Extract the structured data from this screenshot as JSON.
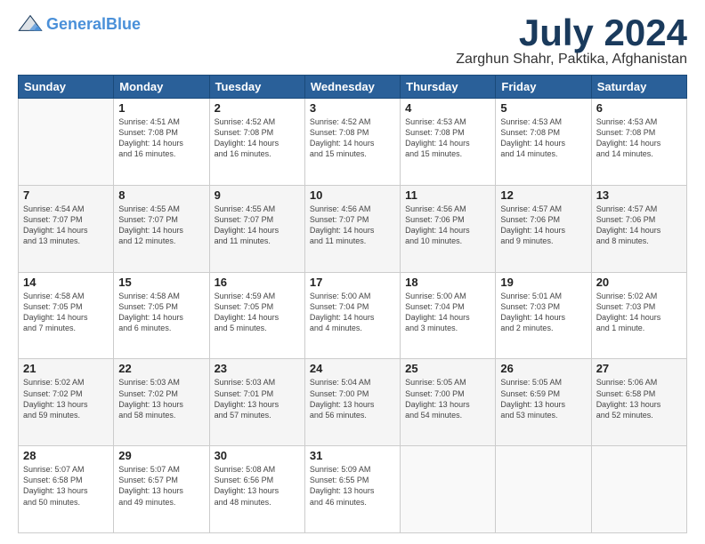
{
  "logo": {
    "name1": "General",
    "name2": "Blue",
    "tagline": ""
  },
  "title": "July 2024",
  "subtitle": "Zarghun Shahr, Paktika, Afghanistan",
  "headers": [
    "Sunday",
    "Monday",
    "Tuesday",
    "Wednesday",
    "Thursday",
    "Friday",
    "Saturday"
  ],
  "weeks": [
    [
      {
        "num": "",
        "info": ""
      },
      {
        "num": "1",
        "info": "Sunrise: 4:51 AM\nSunset: 7:08 PM\nDaylight: 14 hours\nand 16 minutes."
      },
      {
        "num": "2",
        "info": "Sunrise: 4:52 AM\nSunset: 7:08 PM\nDaylight: 14 hours\nand 16 minutes."
      },
      {
        "num": "3",
        "info": "Sunrise: 4:52 AM\nSunset: 7:08 PM\nDaylight: 14 hours\nand 15 minutes."
      },
      {
        "num": "4",
        "info": "Sunrise: 4:53 AM\nSunset: 7:08 PM\nDaylight: 14 hours\nand 15 minutes."
      },
      {
        "num": "5",
        "info": "Sunrise: 4:53 AM\nSunset: 7:08 PM\nDaylight: 14 hours\nand 14 minutes."
      },
      {
        "num": "6",
        "info": "Sunrise: 4:53 AM\nSunset: 7:08 PM\nDaylight: 14 hours\nand 14 minutes."
      }
    ],
    [
      {
        "num": "7",
        "info": "Sunrise: 4:54 AM\nSunset: 7:07 PM\nDaylight: 14 hours\nand 13 minutes."
      },
      {
        "num": "8",
        "info": "Sunrise: 4:55 AM\nSunset: 7:07 PM\nDaylight: 14 hours\nand 12 minutes."
      },
      {
        "num": "9",
        "info": "Sunrise: 4:55 AM\nSunset: 7:07 PM\nDaylight: 14 hours\nand 11 minutes."
      },
      {
        "num": "10",
        "info": "Sunrise: 4:56 AM\nSunset: 7:07 PM\nDaylight: 14 hours\nand 11 minutes."
      },
      {
        "num": "11",
        "info": "Sunrise: 4:56 AM\nSunset: 7:06 PM\nDaylight: 14 hours\nand 10 minutes."
      },
      {
        "num": "12",
        "info": "Sunrise: 4:57 AM\nSunset: 7:06 PM\nDaylight: 14 hours\nand 9 minutes."
      },
      {
        "num": "13",
        "info": "Sunrise: 4:57 AM\nSunset: 7:06 PM\nDaylight: 14 hours\nand 8 minutes."
      }
    ],
    [
      {
        "num": "14",
        "info": "Sunrise: 4:58 AM\nSunset: 7:05 PM\nDaylight: 14 hours\nand 7 minutes."
      },
      {
        "num": "15",
        "info": "Sunrise: 4:58 AM\nSunset: 7:05 PM\nDaylight: 14 hours\nand 6 minutes."
      },
      {
        "num": "16",
        "info": "Sunrise: 4:59 AM\nSunset: 7:05 PM\nDaylight: 14 hours\nand 5 minutes."
      },
      {
        "num": "17",
        "info": "Sunrise: 5:00 AM\nSunset: 7:04 PM\nDaylight: 14 hours\nand 4 minutes."
      },
      {
        "num": "18",
        "info": "Sunrise: 5:00 AM\nSunset: 7:04 PM\nDaylight: 14 hours\nand 3 minutes."
      },
      {
        "num": "19",
        "info": "Sunrise: 5:01 AM\nSunset: 7:03 PM\nDaylight: 14 hours\nand 2 minutes."
      },
      {
        "num": "20",
        "info": "Sunrise: 5:02 AM\nSunset: 7:03 PM\nDaylight: 14 hours\nand 1 minute."
      }
    ],
    [
      {
        "num": "21",
        "info": "Sunrise: 5:02 AM\nSunset: 7:02 PM\nDaylight: 13 hours\nand 59 minutes."
      },
      {
        "num": "22",
        "info": "Sunrise: 5:03 AM\nSunset: 7:02 PM\nDaylight: 13 hours\nand 58 minutes."
      },
      {
        "num": "23",
        "info": "Sunrise: 5:03 AM\nSunset: 7:01 PM\nDaylight: 13 hours\nand 57 minutes."
      },
      {
        "num": "24",
        "info": "Sunrise: 5:04 AM\nSunset: 7:00 PM\nDaylight: 13 hours\nand 56 minutes."
      },
      {
        "num": "25",
        "info": "Sunrise: 5:05 AM\nSunset: 7:00 PM\nDaylight: 13 hours\nand 54 minutes."
      },
      {
        "num": "26",
        "info": "Sunrise: 5:05 AM\nSunset: 6:59 PM\nDaylight: 13 hours\nand 53 minutes."
      },
      {
        "num": "27",
        "info": "Sunrise: 5:06 AM\nSunset: 6:58 PM\nDaylight: 13 hours\nand 52 minutes."
      }
    ],
    [
      {
        "num": "28",
        "info": "Sunrise: 5:07 AM\nSunset: 6:58 PM\nDaylight: 13 hours\nand 50 minutes."
      },
      {
        "num": "29",
        "info": "Sunrise: 5:07 AM\nSunset: 6:57 PM\nDaylight: 13 hours\nand 49 minutes."
      },
      {
        "num": "30",
        "info": "Sunrise: 5:08 AM\nSunset: 6:56 PM\nDaylight: 13 hours\nand 48 minutes."
      },
      {
        "num": "31",
        "info": "Sunrise: 5:09 AM\nSunset: 6:55 PM\nDaylight: 13 hours\nand 46 minutes."
      },
      {
        "num": "",
        "info": ""
      },
      {
        "num": "",
        "info": ""
      },
      {
        "num": "",
        "info": ""
      }
    ]
  ]
}
